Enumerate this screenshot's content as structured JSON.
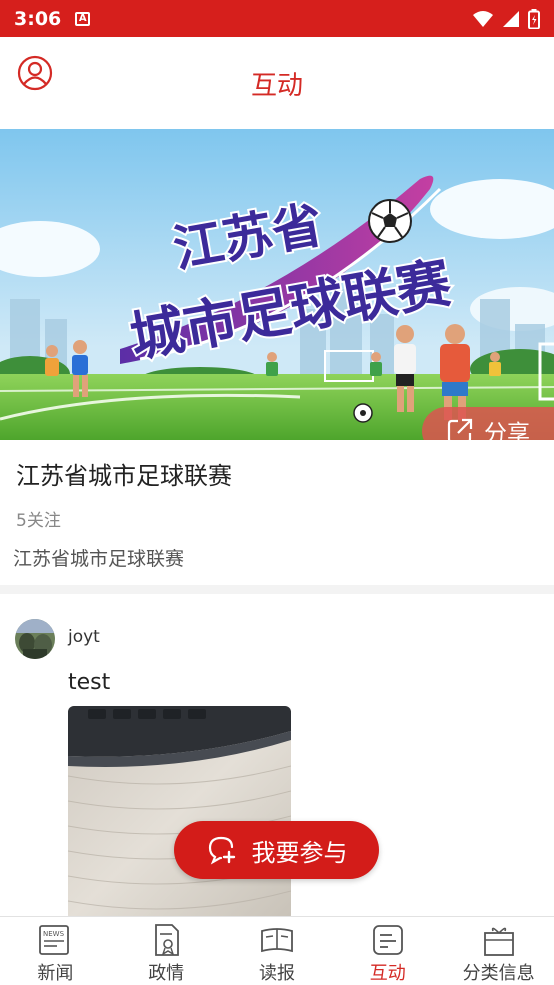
{
  "status_bar": {
    "time": "3:06",
    "notification_glyph": "A"
  },
  "header": {
    "title": "互动"
  },
  "banner": {
    "line1": "江苏省",
    "line2": "城市足球联赛",
    "share_label": "分享"
  },
  "topic": {
    "title": "江苏省城市足球联赛",
    "followers": "5关注",
    "description": "江苏省城市足球联赛"
  },
  "post": {
    "username": "joyt",
    "text": "test"
  },
  "join_button": {
    "label": "我要参与"
  },
  "tabs": [
    {
      "label": "新闻",
      "icon": "news-icon"
    },
    {
      "label": "政情",
      "icon": "document-badge-icon"
    },
    {
      "label": "读报",
      "icon": "newspaper-icon"
    },
    {
      "label": "互动",
      "icon": "interaction-icon",
      "active": true
    },
    {
      "label": "分类信息",
      "icon": "gift-box-icon"
    }
  ],
  "colors": {
    "brand_red": "#d61f1c",
    "active_tab": "#d42a25"
  }
}
